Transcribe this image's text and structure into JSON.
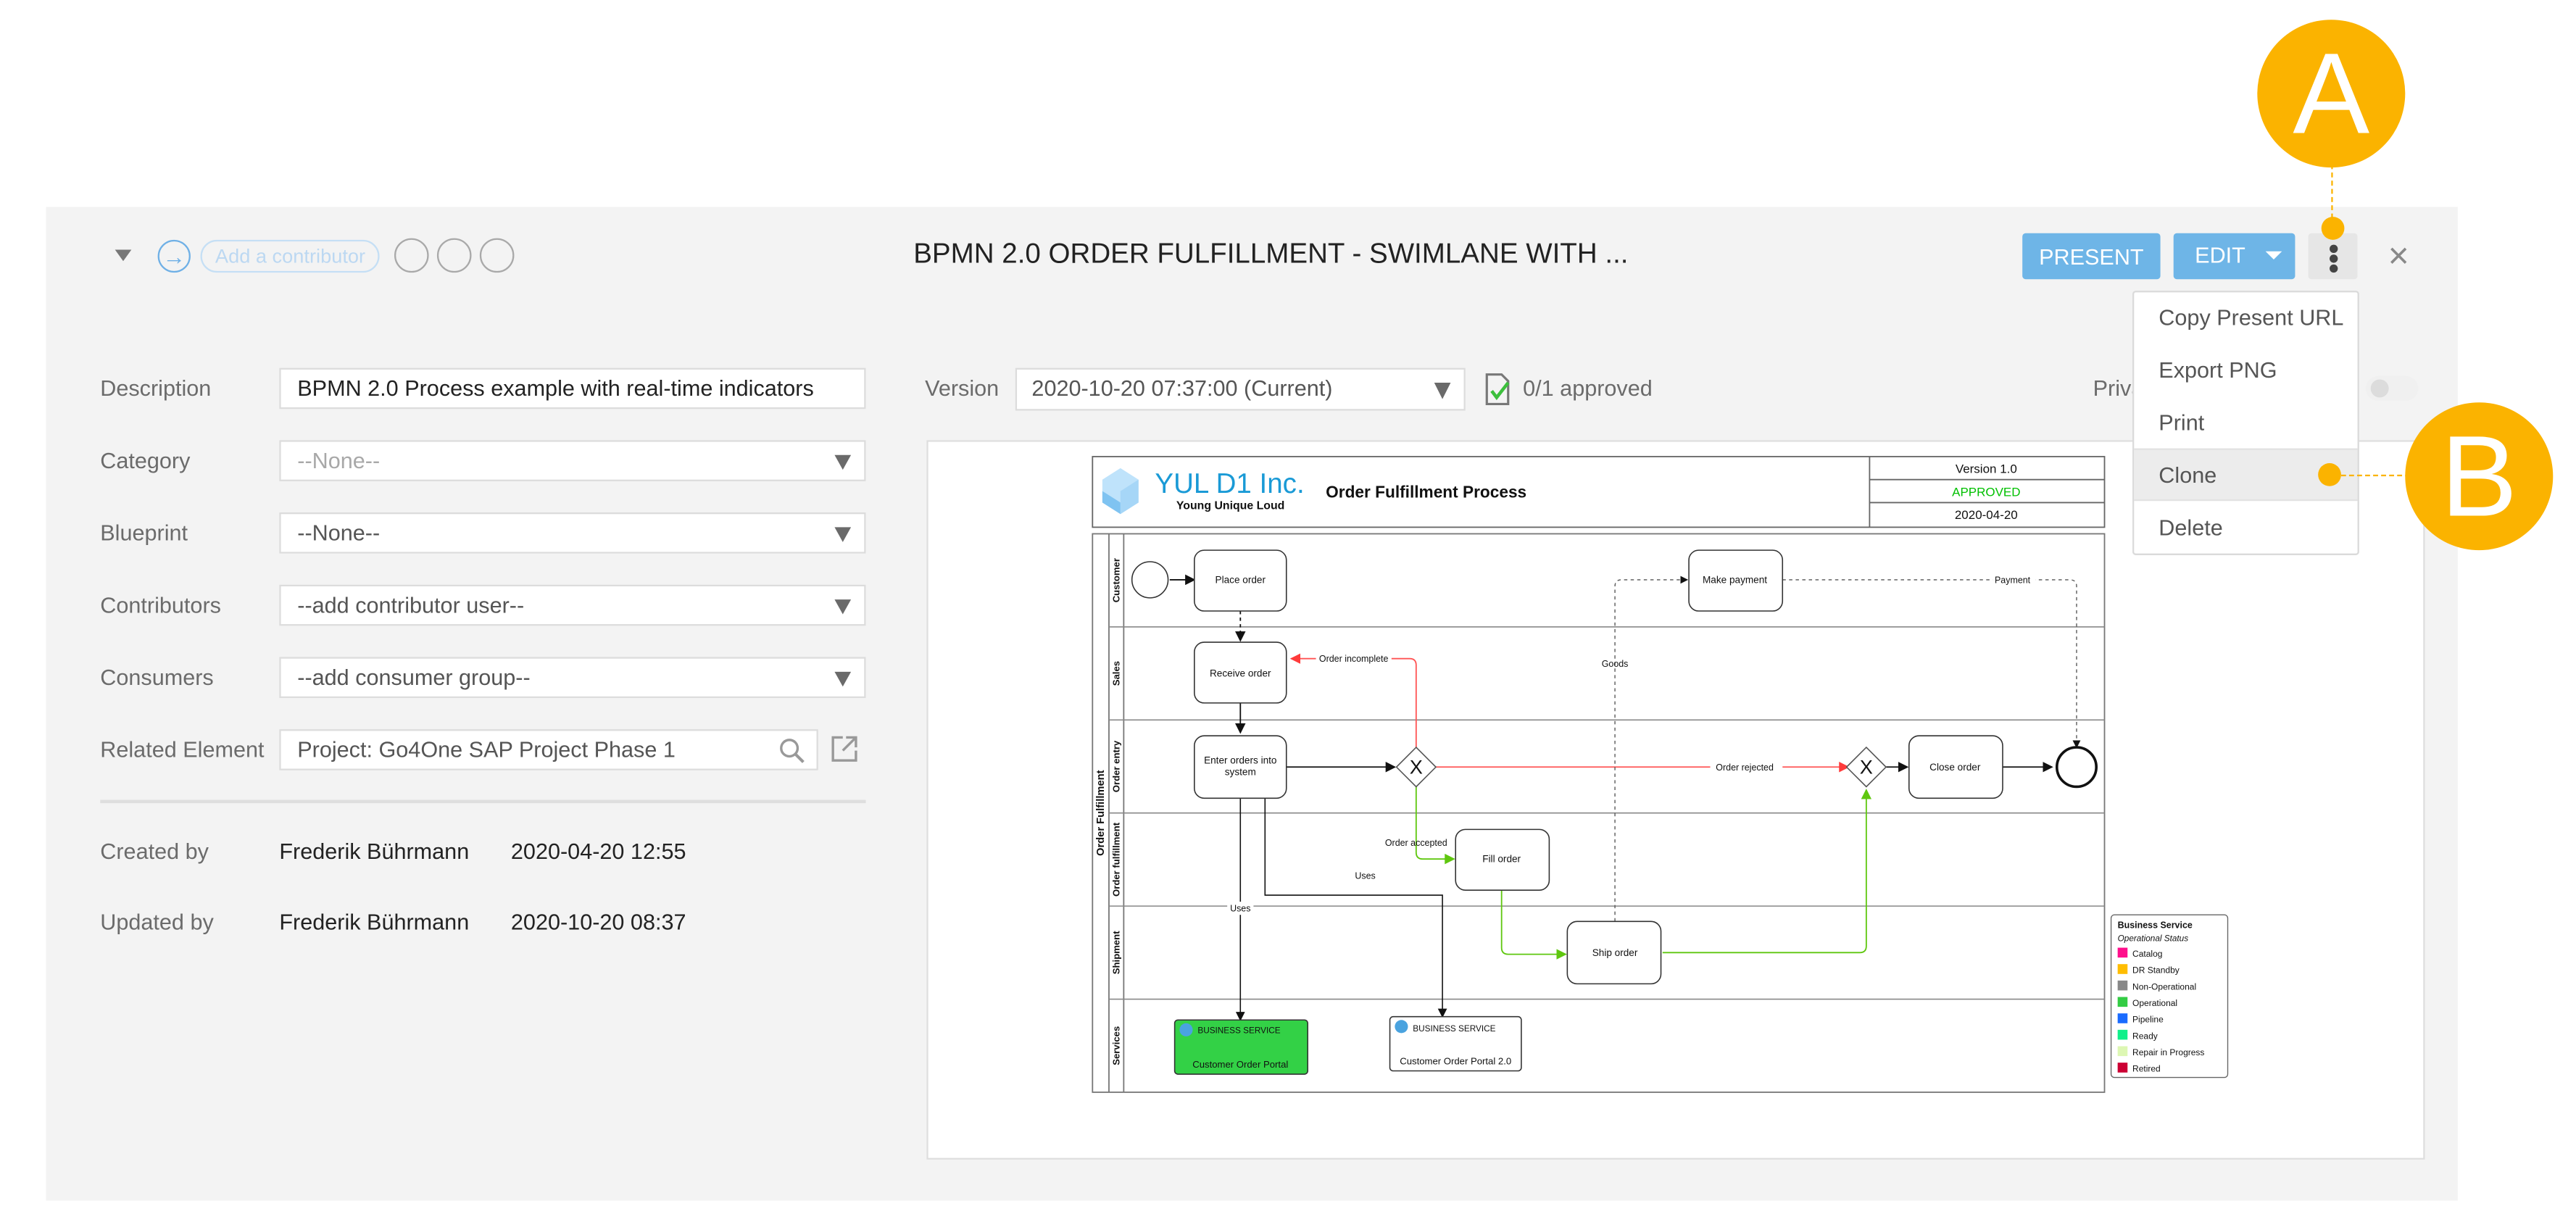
{
  "header": {
    "add_contributor_placeholder": "Add a contributor",
    "title": "BPMN 2.0 ORDER FULFILLMENT - SWIMLANE WITH ...",
    "present_label": "PRESENT",
    "edit_label": "EDIT",
    "close_glyph": "×",
    "arrow_glyph": "→"
  },
  "form": {
    "description": {
      "label": "Description",
      "value": "BPMN 2.0 Process example with real-time indicators"
    },
    "category": {
      "label": "Category",
      "value": "--None--"
    },
    "blueprint": {
      "label": "Blueprint",
      "value": "--None--"
    },
    "contributors": {
      "label": "Contributors",
      "value": "--add contributor user--"
    },
    "consumers": {
      "label": "Consumers",
      "value": "--add consumer group--"
    },
    "related_element": {
      "label": "Related Element",
      "value": "Project: Go4One SAP Project Phase 1"
    },
    "created": {
      "label": "Created by",
      "user": "Frederik Bührmann",
      "date": "2020-04-20 12:55"
    },
    "updated": {
      "label": "Updated by",
      "user": "Frederik Bührmann",
      "date": "2020-10-20 08:37"
    }
  },
  "version": {
    "label": "Version",
    "selected": "2020-10-20 07:37:00 (Current)",
    "approval": "0/1 approved",
    "private_label": "Private"
  },
  "menu": {
    "items": [
      {
        "label": "Copy Present URL"
      },
      {
        "label": "Export PNG"
      },
      {
        "label": "Print"
      },
      {
        "label": "Clone",
        "highlighted": true
      },
      {
        "label": "Delete"
      }
    ]
  },
  "callouts": {
    "a": "A",
    "b": "B",
    "color": "#fbb300"
  },
  "diagram": {
    "company": "YUL D1 Inc.",
    "tagline": "Young Unique Loud",
    "process_title": "Order Fulfillment Process",
    "version": "Version 1.0",
    "status": "APPROVED",
    "status_color": "#00c000",
    "date": "2020-04-20",
    "pool": "Order Fulfillment",
    "lanes": [
      "Customer",
      "Sales",
      "Order entry",
      "Order fulfillment",
      "Shipment",
      "Services"
    ],
    "tasks": {
      "place_order": "Place order",
      "receive_order": "Receive order",
      "enter_orders": [
        "Enter orders into",
        "system"
      ],
      "make_payment": "Make payment",
      "close_order": "Close order",
      "fill_order": "Fill order",
      "ship_order": "Ship order"
    },
    "flow_labels": {
      "order_incomplete": "Order incomplete",
      "order_rejected": "Order rejected",
      "order_accepted": "Order accepted",
      "goods": "Goods",
      "payment": "Payment",
      "uses_1": "Uses",
      "uses_2": "Uses"
    },
    "services": [
      {
        "type": "BUSINESS SERVICE",
        "name": "Customer Order Portal",
        "fill": "#33d146"
      },
      {
        "type": "BUSINESS SERVICE",
        "name": "Customer Order Portal 2.0",
        "fill": "#ffffff"
      }
    ],
    "legend": {
      "title": "Business Service",
      "subtitle": "Operational Status",
      "items": [
        {
          "label": "Catalog",
          "color": "#ff0f8c"
        },
        {
          "label": "DR Standby",
          "color": "#ffbd00"
        },
        {
          "label": "Non-Operational",
          "color": "#888888"
        },
        {
          "label": "Operational",
          "color": "#33cc44"
        },
        {
          "label": "Pipeline",
          "color": "#1a6bff"
        },
        {
          "label": "Ready",
          "color": "#10f08a"
        },
        {
          "label": "Repair in Progress",
          "color": "#ddf7b3"
        },
        {
          "label": "Retired",
          "color": "#cc0033"
        }
      ]
    }
  }
}
